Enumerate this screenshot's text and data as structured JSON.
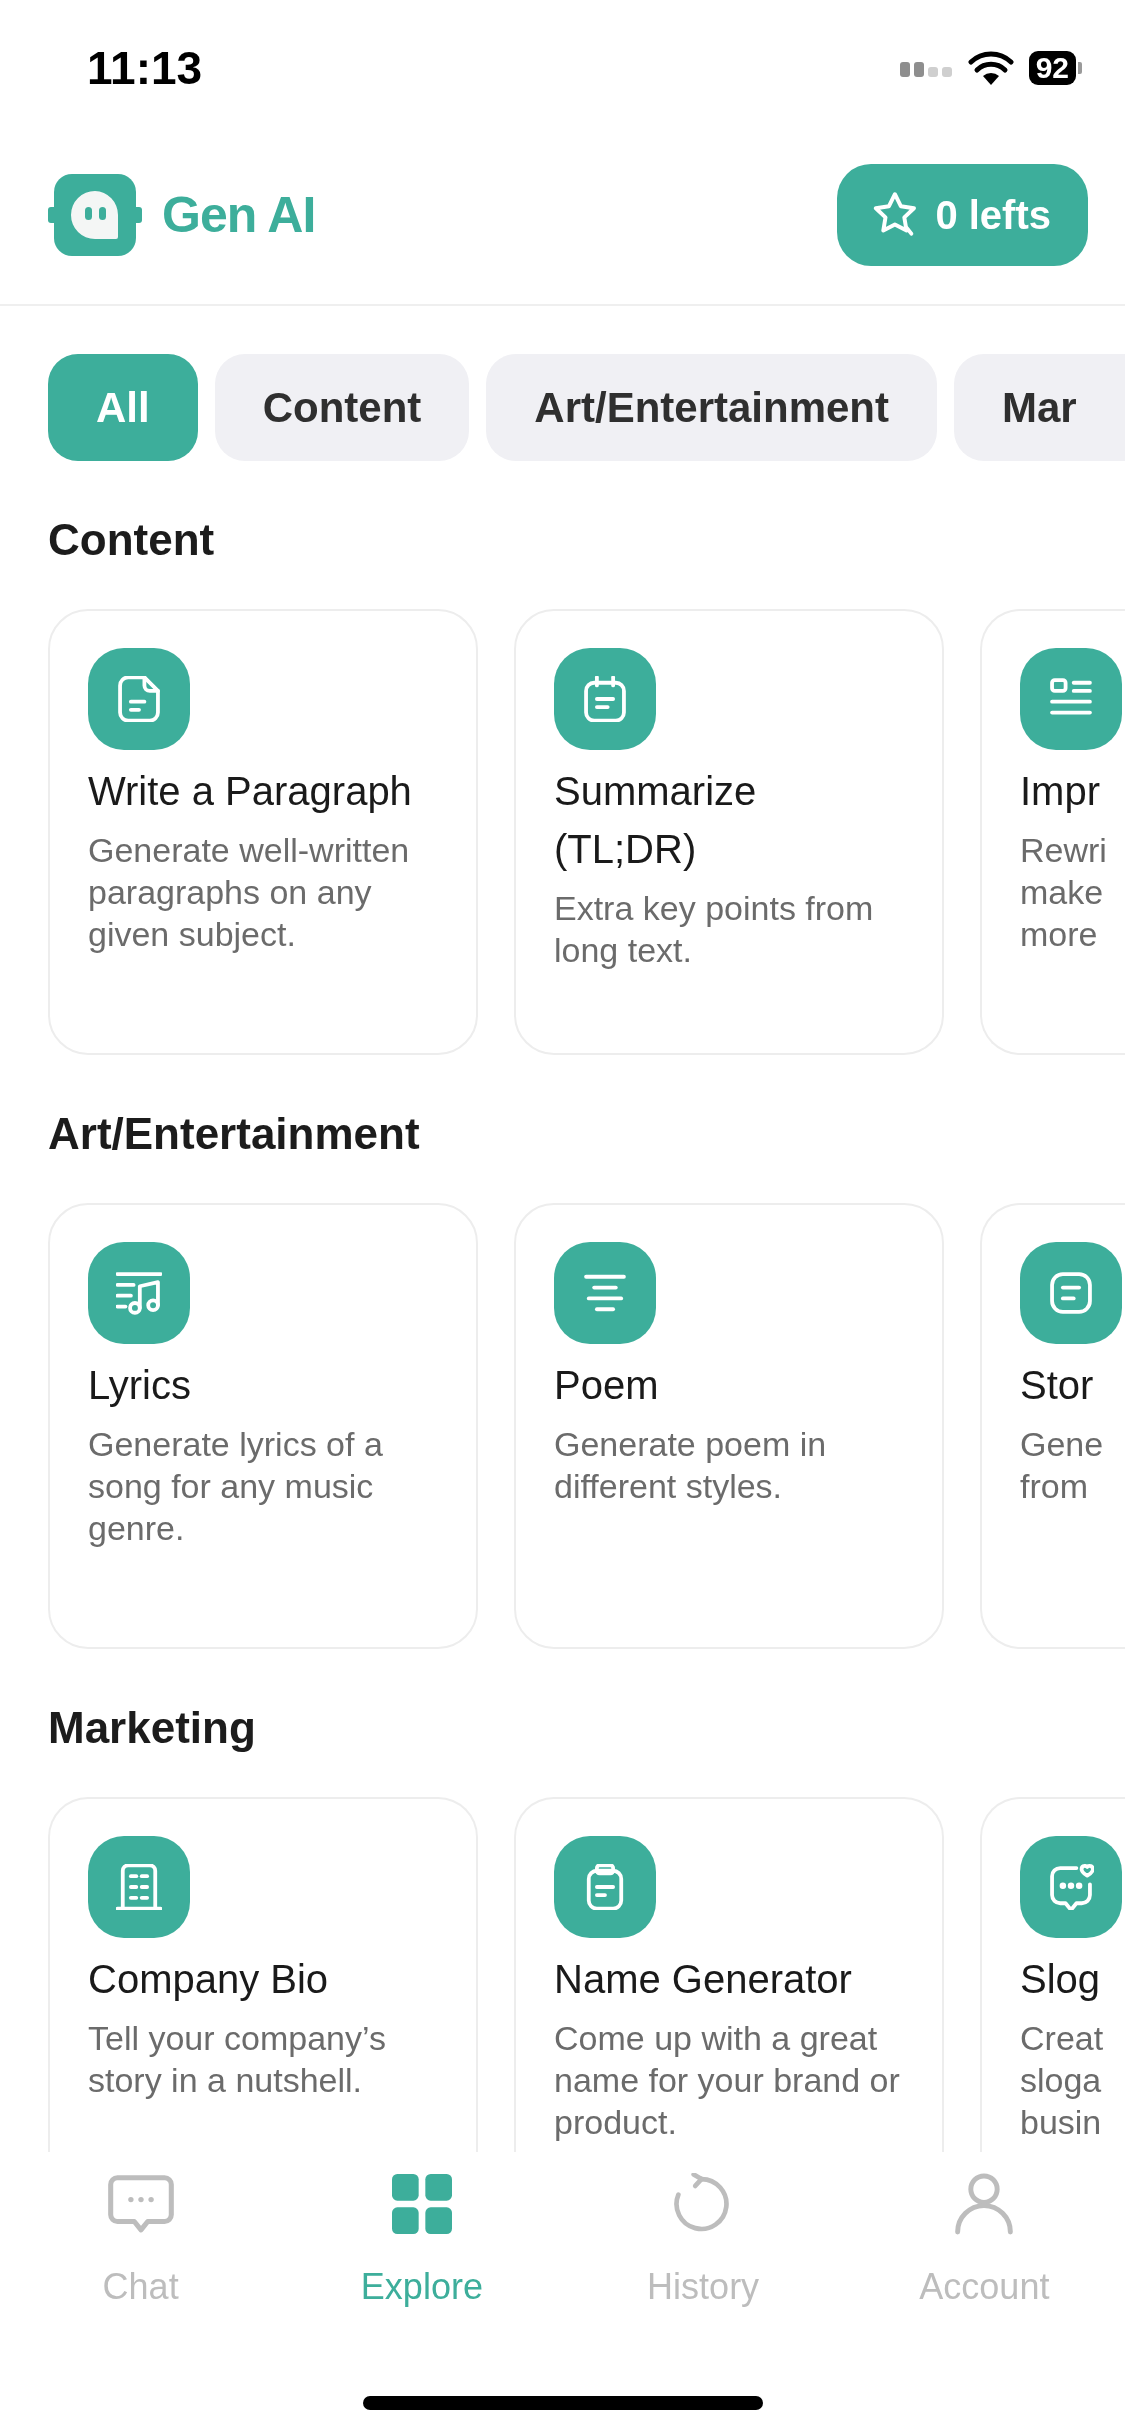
{
  "status_bar": {
    "time": "11:13",
    "battery": "92"
  },
  "header": {
    "app_name": "Gen AI",
    "credits_button": "0 lefts"
  },
  "tabs": [
    {
      "label": "All",
      "selected": true
    },
    {
      "label": "Content",
      "selected": false
    },
    {
      "label": "Art/Entertainment",
      "selected": false
    },
    {
      "label": "Mar",
      "selected": false
    }
  ],
  "sections": [
    {
      "title": "Content",
      "cards": [
        {
          "title": "Write a Paragraph",
          "description": "Generate well-written paragraphs on any given subject."
        },
        {
          "title": "Summarize (TL;DR)",
          "description": "Extra key points from long text."
        },
        {
          "title": "Impr",
          "description": "Rewri make more"
        }
      ]
    },
    {
      "title": "Art/Entertainment",
      "cards": [
        {
          "title": "Lyrics",
          "description": "Generate lyrics of a song for any music genre."
        },
        {
          "title": "Poem",
          "description": "Generate poem in different styles."
        },
        {
          "title": "Stor",
          "description": "Gene from"
        }
      ]
    },
    {
      "title": "Marketing",
      "cards": [
        {
          "title": "Company Bio",
          "description": "Tell your company’s story in a nutshell."
        },
        {
          "title": "Name Generator",
          "description": "Come up with a great name for your brand or product."
        },
        {
          "title": "Slog",
          "description": "Creat sloga busin"
        }
      ]
    }
  ],
  "nav": [
    {
      "label": "Chat",
      "selected": false
    },
    {
      "label": "Explore",
      "selected": true
    },
    {
      "label": "History",
      "selected": false
    },
    {
      "label": "Account",
      "selected": false
    }
  ]
}
